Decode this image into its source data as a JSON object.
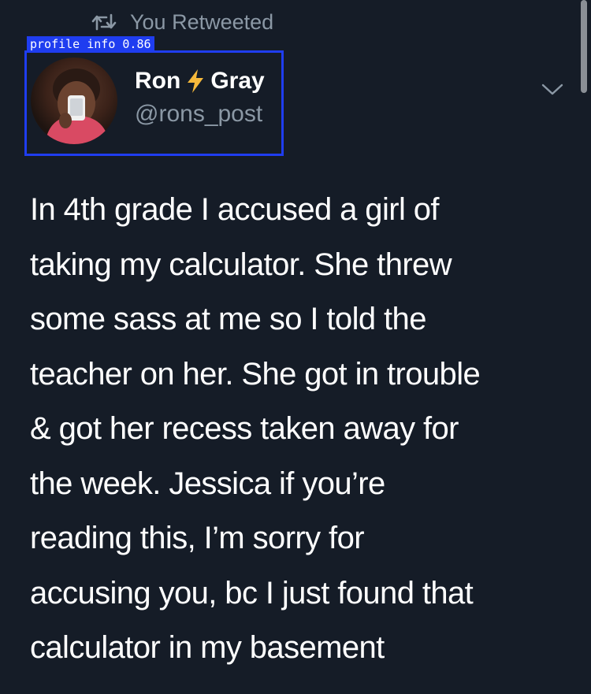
{
  "retweet": {
    "label": "You Retweeted",
    "icon": "retweet-icon"
  },
  "detection": {
    "label": "profile_info 0.86",
    "color": "#1f3df0"
  },
  "profile": {
    "name_first": "Ron",
    "name_last": "Gray",
    "emoji": "lightning-bolt-icon",
    "handle": "@rons_post",
    "avatar": "avatar"
  },
  "menu": {
    "icon": "chevron-down-icon"
  },
  "tweet": {
    "text": "In 4th grade I accused a girl of\ntaking my calculator.  She threw\nsome sass at me so I told the\nteacher on her. She got in trouble\n& got her recess taken away for\nthe week. Jessica if you’re\nreading this, I’m sorry for\naccusing you, bc I just found that\ncalculator in my basement"
  },
  "colors": {
    "background": "#151c27",
    "secondary_text": "#8b98a5",
    "primary_text": "#ffffff",
    "bolt": "#f6b93b"
  }
}
